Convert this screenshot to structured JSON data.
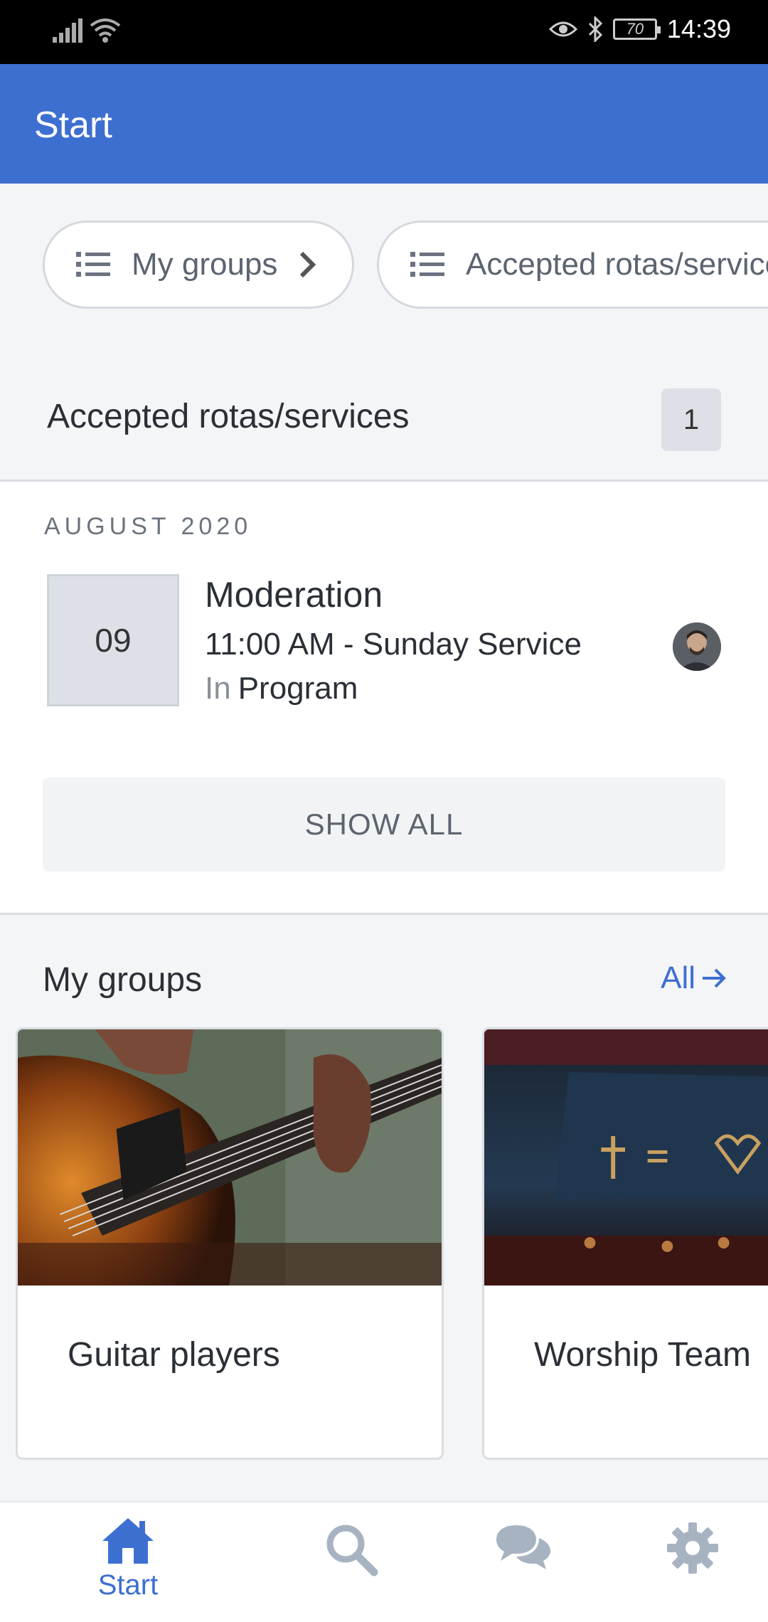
{
  "status_bar": {
    "time": "14:39",
    "battery": "70"
  },
  "app_bar": {
    "title": "Start"
  },
  "chips": [
    {
      "label": "My groups",
      "icon": "list-icon"
    },
    {
      "label": "Accepted rotas/services",
      "icon": "list-icon"
    }
  ],
  "accepted": {
    "title": "Accepted rotas/services",
    "count": "1",
    "month": "AUGUST 2020",
    "item": {
      "day": "09",
      "title": "Moderation",
      "time": "11:00 AM - Sunday Service",
      "in_label": "In",
      "in_value": "Program"
    },
    "show_all": "SHOW ALL"
  },
  "groups": {
    "title": "My groups",
    "all_label": "All",
    "items": [
      {
        "name": "Guitar players"
      },
      {
        "name": "Worship Team"
      }
    ]
  },
  "bottom_nav": {
    "start_label": "Start",
    "active_color": "#3d6fd1",
    "inactive_color": "#a8b3c2"
  },
  "colors": {
    "primary": "#3d6fd1",
    "background": "#f4f5f7"
  }
}
